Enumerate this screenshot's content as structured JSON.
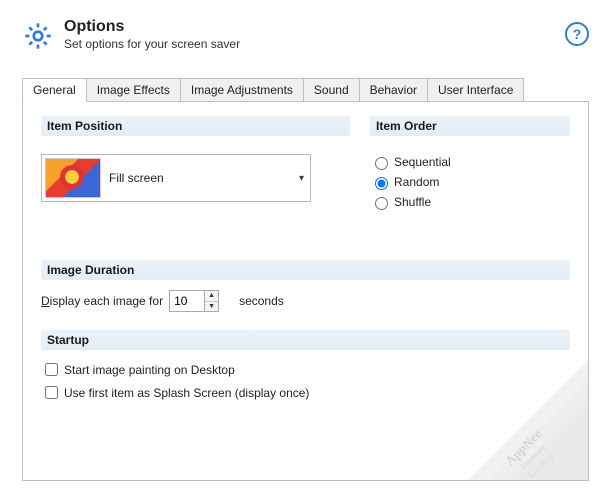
{
  "header": {
    "title": "Options",
    "subtitle": "Set options for your screen saver"
  },
  "tabs": {
    "items": [
      {
        "label": "General",
        "active": true
      },
      {
        "label": "Image Effects"
      },
      {
        "label": "Image Adjustments"
      },
      {
        "label": "Sound"
      },
      {
        "label": "Behavior"
      },
      {
        "label": "User Interface"
      }
    ]
  },
  "item_position": {
    "heading": "Item Position",
    "selected": "Fill screen"
  },
  "item_order": {
    "heading": "Item Order",
    "options": [
      "Sequential",
      "Random",
      "Shuffle"
    ],
    "selected": "Random"
  },
  "image_duration": {
    "heading": "Image Duration",
    "prefix_underline": "D",
    "prefix_rest": "isplay each image for",
    "value": "10",
    "suffix": "seconds"
  },
  "startup": {
    "heading": "Startup",
    "opt1": "Start image painting on Desktop",
    "opt2": "Use first item as Splash Screen (display once)"
  },
  "watermark": {
    "line1": "AppNee",
    "line2": "Freeware",
    "line3": "Group"
  }
}
